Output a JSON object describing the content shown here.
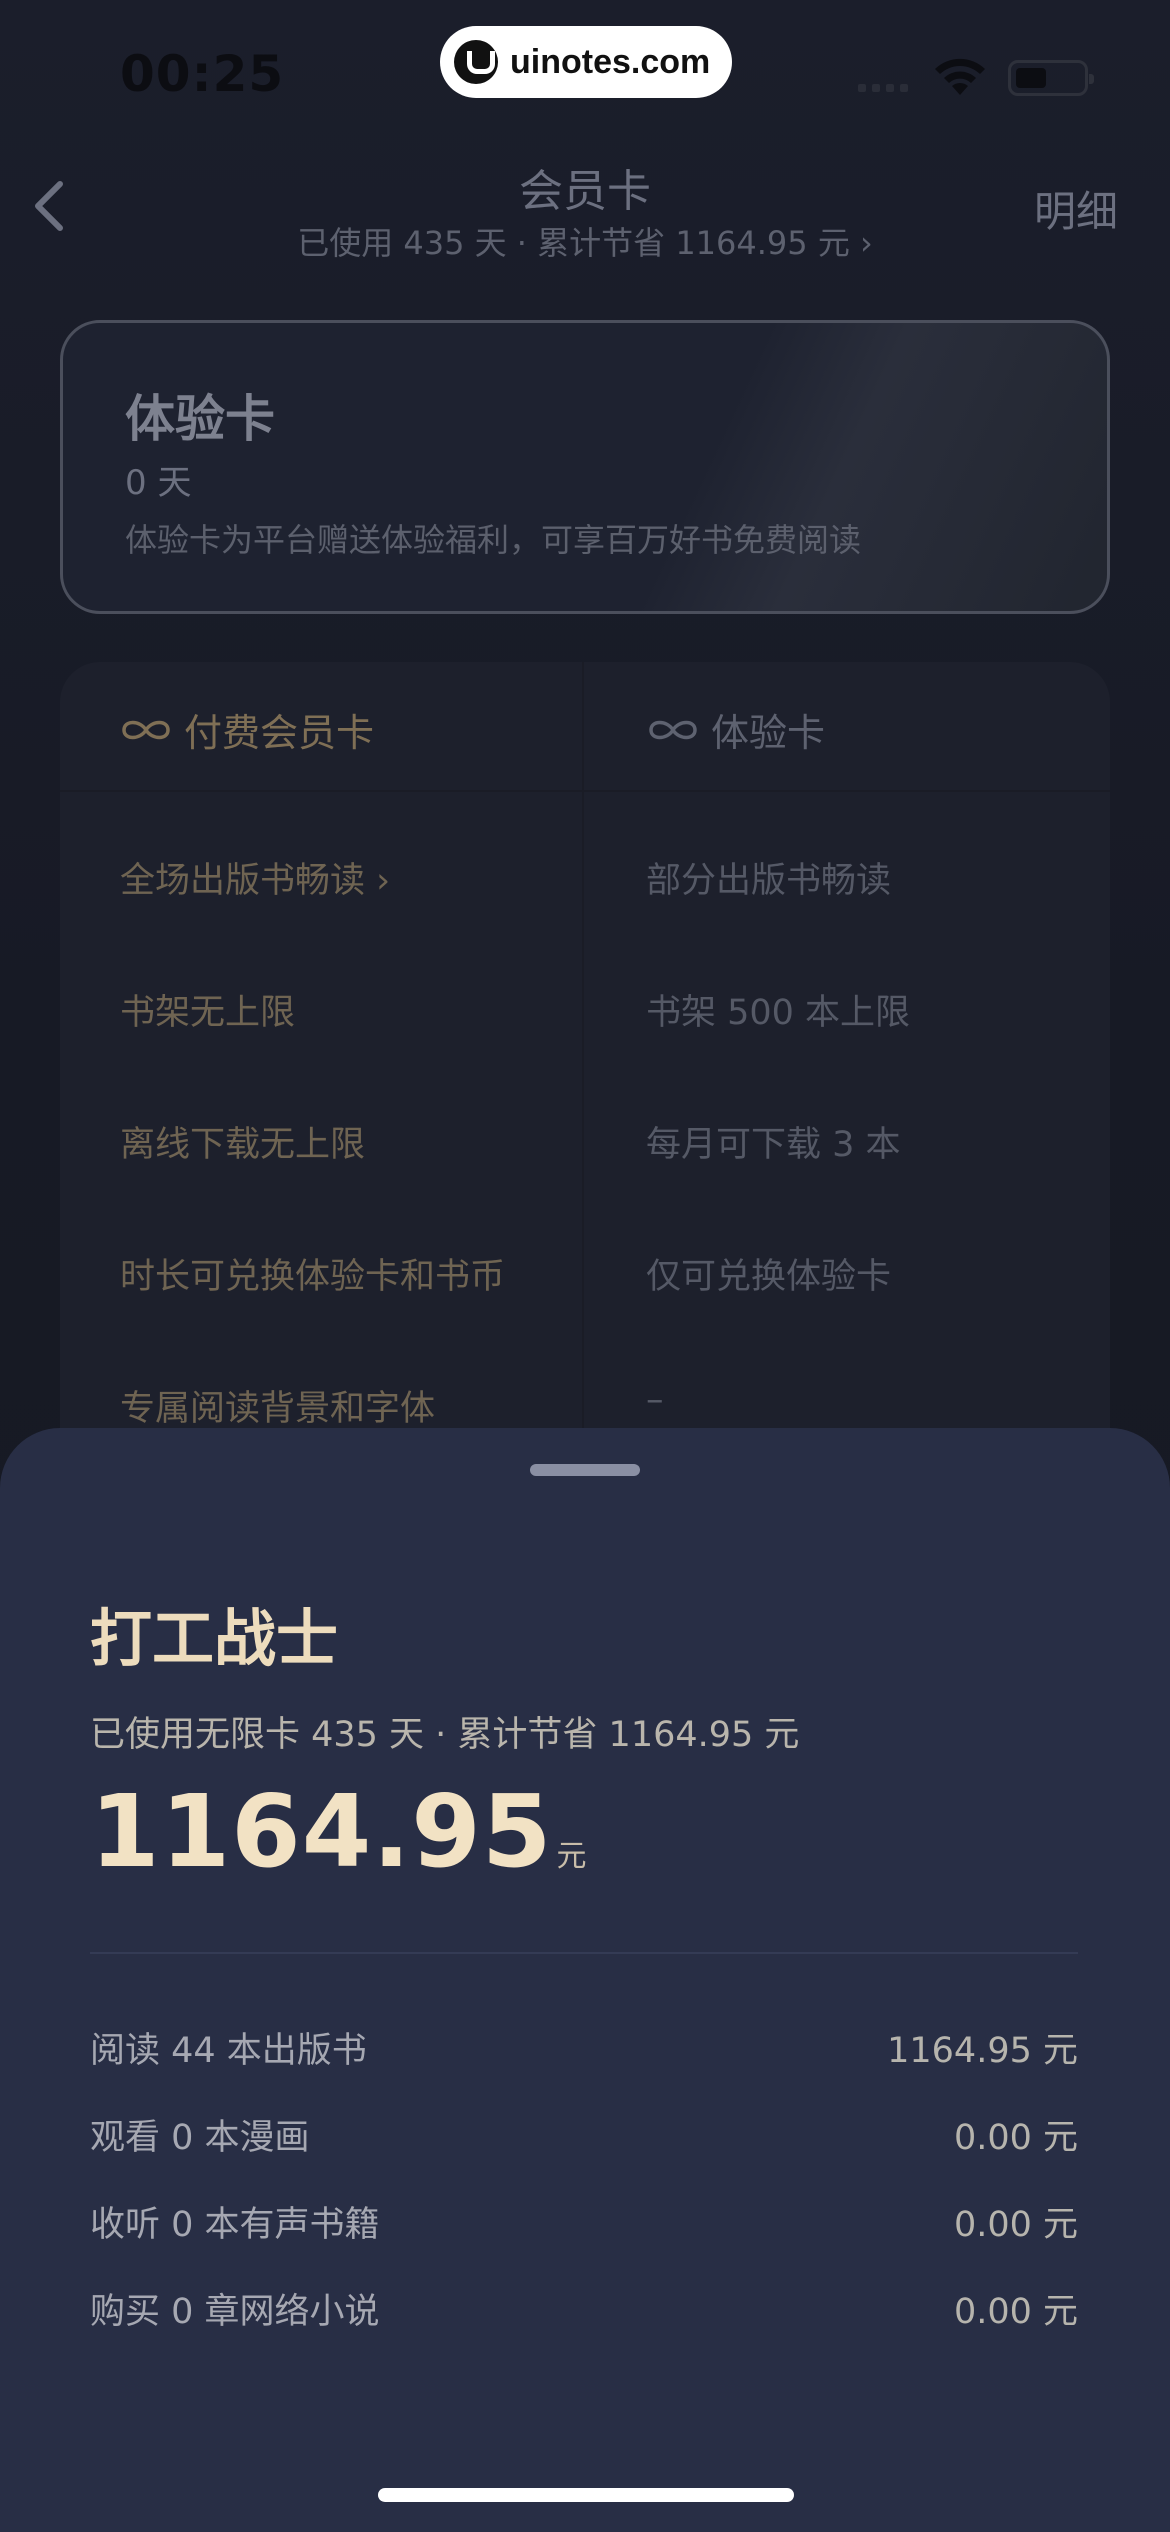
{
  "status_bar": {
    "time": "00:25"
  },
  "watermark": {
    "text": "uinotes.com"
  },
  "nav": {
    "title": "会员卡",
    "subtitle": "已使用 435 天 · 累计节省 1164.95 元 ›",
    "detail_label": "明细"
  },
  "trial_card": {
    "title": "体验卡",
    "days": "0 天",
    "description": "体验卡为平台赠送体验福利，可享百万好书免费阅读"
  },
  "compare": {
    "paid_header": "付费会员卡",
    "trial_header": "体验卡",
    "rows": [
      {
        "paid": "全场出版书畅读 ›",
        "trial": "部分出版书畅读"
      },
      {
        "paid": "书架无上限",
        "trial": "书架 500 本上限"
      },
      {
        "paid": "离线下载无上限",
        "trial": "每月可下载 3 本"
      },
      {
        "paid": "时长可兑换体验卡和书币",
        "trial": "仅可兑换体验卡"
      },
      {
        "paid": "专属阅读背景和字体",
        "trial": "–"
      }
    ]
  },
  "sheet": {
    "title": "打工战士",
    "summary": "已使用无限卡 435 天 · 累计节省 1164.95 元",
    "amount": "1164.95",
    "amount_unit": "元",
    "stats": [
      {
        "label": "阅读 44 本出版书",
        "value": "1164.95 元"
      },
      {
        "label": "观看 0 本漫画",
        "value": "0.00 元"
      },
      {
        "label": "收听 0 本有声书籍",
        "value": "0.00 元"
      },
      {
        "label": "购买 0 章网络小说",
        "value": "0.00 元"
      }
    ]
  },
  "colors": {
    "background": "#1b1e2b",
    "sheet": "#282e45",
    "gold_accent": "#eddcbd"
  }
}
